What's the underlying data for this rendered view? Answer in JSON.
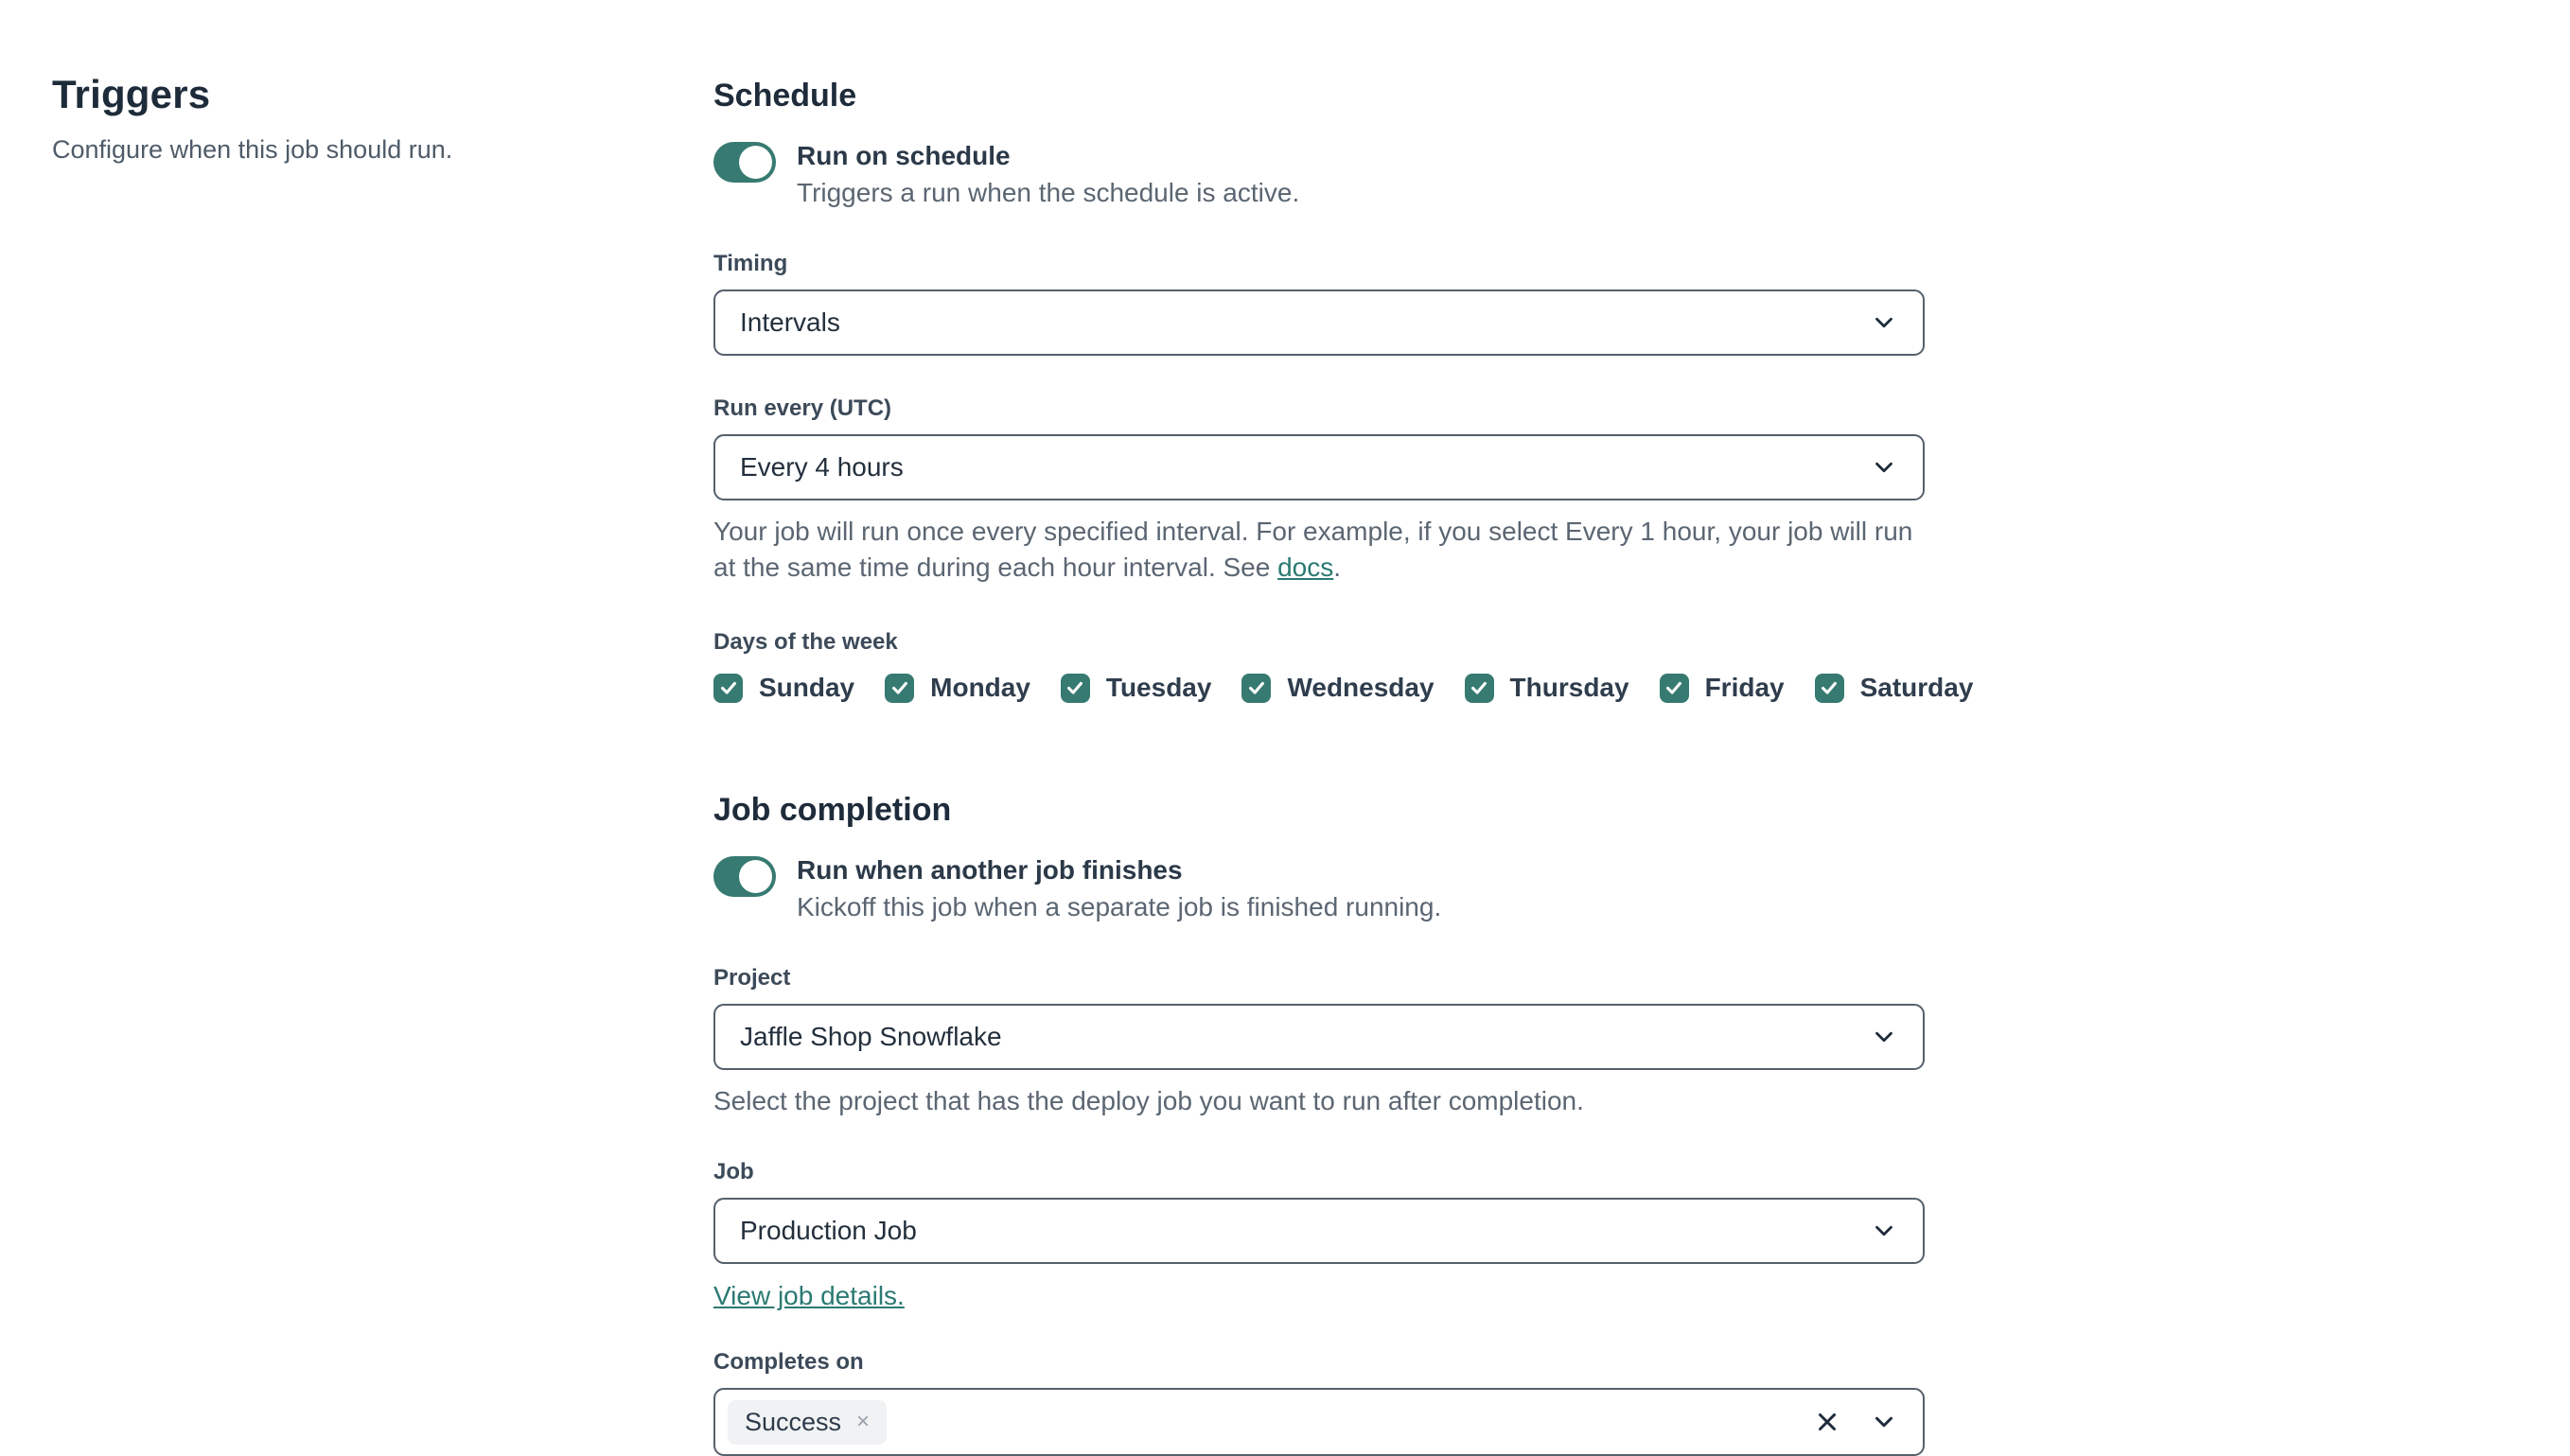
{
  "colors": {
    "teal": "#377a71",
    "link_teal": "#2a7a72",
    "heading": "#1e2b3a"
  },
  "sidebar": {
    "title": "Triggers",
    "subtitle": "Configure when this job should run."
  },
  "schedule": {
    "heading": "Schedule",
    "toggle": {
      "label": "Run on schedule",
      "description": "Triggers a run when the schedule is active.",
      "state": "on"
    },
    "timing": {
      "label": "Timing",
      "value": "Intervals"
    },
    "run_every": {
      "label": "Run every (UTC)",
      "value": "Every 4 hours"
    },
    "help": {
      "before": "Your job will run once every specified interval. For example, if you select Every 1 hour, your job will run at the same time during each hour interval. See ",
      "link": "docs",
      "after": "."
    },
    "days": {
      "label": "Days of the week",
      "items": [
        {
          "label": "Sunday",
          "checked": true
        },
        {
          "label": "Monday",
          "checked": true
        },
        {
          "label": "Tuesday",
          "checked": true
        },
        {
          "label": "Wednesday",
          "checked": true
        },
        {
          "label": "Thursday",
          "checked": true
        },
        {
          "label": "Friday",
          "checked": true
        },
        {
          "label": "Saturday",
          "checked": true
        }
      ]
    }
  },
  "job_completion": {
    "heading": "Job completion",
    "toggle": {
      "label": "Run when another job finishes",
      "description": "Kickoff this job when a separate job is finished running.",
      "state": "on"
    },
    "project": {
      "label": "Project",
      "value": "Jaffle Shop Snowflake",
      "help": "Select the project that has the deploy job you want to run after completion."
    },
    "job": {
      "label": "Job",
      "value": "Production Job",
      "link": "View job details."
    },
    "completes_on": {
      "label": "Completes on",
      "selected_tags": [
        "Success"
      ],
      "tag_remove_icon": "×"
    }
  }
}
